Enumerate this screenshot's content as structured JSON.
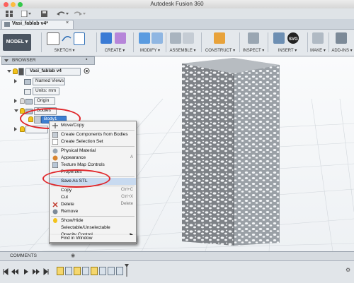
{
  "app": {
    "title": "Autodesk Fusion 360"
  },
  "document_tab": {
    "label": "Vasi_fablab v4*"
  },
  "toolbar": {
    "workspace": "MODEL ▾",
    "groups": [
      "SKETCH ▾",
      "CREATE ▾",
      "MODIFY ▾",
      "ASSEMBLE ▾",
      "CONSTRUCT ▾",
      "INSPECT ▾",
      "INSERT ▾",
      "MAKE ▾",
      "ADD-INS ▾"
    ]
  },
  "browser": {
    "header": "BROWSER",
    "root": "Vasi_fablab v4",
    "items": [
      "Named Views",
      "Units: mm",
      "Origin",
      "Bodies",
      "Body1"
    ]
  },
  "context_menu": {
    "items": [
      {
        "label": "Move/Copy",
        "shortcut": ""
      },
      {
        "label": "Create Components from Bodies",
        "shortcut": ""
      },
      {
        "label": "Create Selection Set",
        "shortcut": ""
      },
      {
        "label": "Physical Material",
        "shortcut": ""
      },
      {
        "label": "Appearance",
        "shortcut": "A"
      },
      {
        "label": "Texture Map Controls",
        "shortcut": ""
      },
      {
        "label": "Properties",
        "shortcut": ""
      },
      {
        "label": "Save As STL",
        "shortcut": ""
      },
      {
        "label": "Copy",
        "shortcut": "Ctrl+C"
      },
      {
        "label": "Cut",
        "shortcut": "Ctrl+X"
      },
      {
        "label": "Delete",
        "shortcut": "Delete"
      },
      {
        "label": "Remove",
        "shortcut": ""
      },
      {
        "label": "Show/Hide",
        "shortcut": ""
      },
      {
        "label": "Selectable/Unselectable",
        "shortcut": ""
      },
      {
        "label": "Opacity Control",
        "shortcut": ""
      },
      {
        "label": "Find in Window",
        "shortcut": ""
      }
    ]
  },
  "comments": {
    "label": "COMMENTS"
  },
  "colors": {
    "highlight": "#e0262a",
    "selection": "#3d7fd1",
    "hover": "#c8daf0"
  }
}
